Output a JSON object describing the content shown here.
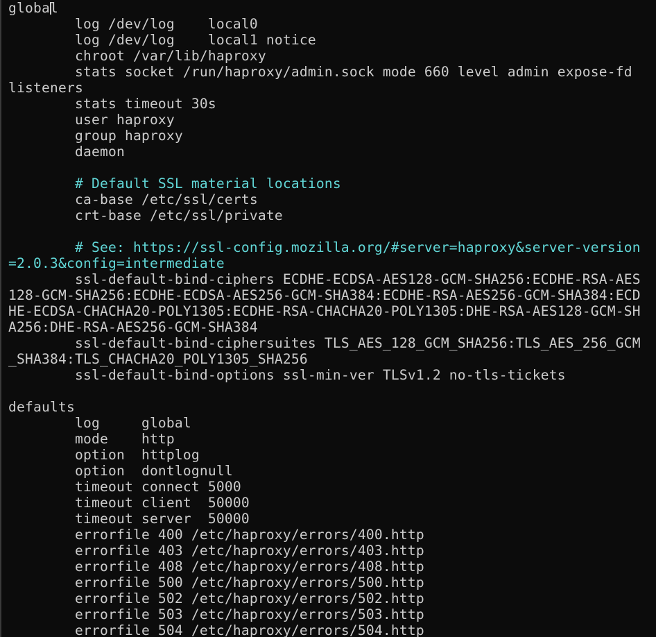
{
  "terminal": {
    "colors": {
      "background": "#0c0c0c",
      "text": "#cccccc",
      "comment": "#61d6d6"
    },
    "lines": [
      {
        "text": "global",
        "kind": "normal"
      },
      {
        "text": "        log /dev/log    local0",
        "kind": "normal"
      },
      {
        "text": "        log /dev/log    local1 notice",
        "kind": "normal"
      },
      {
        "text": "        chroot /var/lib/haproxy",
        "kind": "normal"
      },
      {
        "text": "        stats socket /run/haproxy/admin.sock mode 660 level admin expose-fd",
        "kind": "normal"
      },
      {
        "text": "listeners",
        "kind": "normal"
      },
      {
        "text": "        stats timeout 30s",
        "kind": "normal"
      },
      {
        "text": "        user haproxy",
        "kind": "normal"
      },
      {
        "text": "        group haproxy",
        "kind": "normal"
      },
      {
        "text": "        daemon",
        "kind": "normal"
      },
      {
        "text": "",
        "kind": "blank"
      },
      {
        "text": "        # Default SSL material locations",
        "kind": "comment"
      },
      {
        "text": "        ca-base /etc/ssl/certs",
        "kind": "normal"
      },
      {
        "text": "        crt-base /etc/ssl/private",
        "kind": "normal"
      },
      {
        "text": "",
        "kind": "blank"
      },
      {
        "text": "        # See: https://ssl-config.mozilla.org/#server=haproxy&server-version",
        "kind": "comment"
      },
      {
        "text": "=2.0.3&config=intermediate",
        "kind": "comment"
      },
      {
        "text": "        ssl-default-bind-ciphers ECDHE-ECDSA-AES128-GCM-SHA256:ECDHE-RSA-AES",
        "kind": "normal"
      },
      {
        "text": "128-GCM-SHA256:ECDHE-ECDSA-AES256-GCM-SHA384:ECDHE-RSA-AES256-GCM-SHA384:ECD",
        "kind": "normal"
      },
      {
        "text": "HE-ECDSA-CHACHA20-POLY1305:ECDHE-RSA-CHACHA20-POLY1305:DHE-RSA-AES128-GCM-SH",
        "kind": "normal"
      },
      {
        "text": "A256:DHE-RSA-AES256-GCM-SHA384",
        "kind": "normal"
      },
      {
        "text": "        ssl-default-bind-ciphersuites TLS_AES_128_GCM_SHA256:TLS_AES_256_GCM",
        "kind": "normal"
      },
      {
        "text": "_SHA384:TLS_CHACHA20_POLY1305_SHA256",
        "kind": "normal"
      },
      {
        "text": "        ssl-default-bind-options ssl-min-ver TLSv1.2 no-tls-tickets",
        "kind": "normal"
      },
      {
        "text": "",
        "kind": "blank"
      },
      {
        "text": "defaults",
        "kind": "normal"
      },
      {
        "text": "        log     global",
        "kind": "normal"
      },
      {
        "text": "        mode    http",
        "kind": "normal"
      },
      {
        "text": "        option  httplog",
        "kind": "normal"
      },
      {
        "text": "        option  dontlognull",
        "kind": "normal"
      },
      {
        "text": "        timeout connect 5000",
        "kind": "normal"
      },
      {
        "text": "        timeout client  50000",
        "kind": "normal"
      },
      {
        "text": "        timeout server  50000",
        "kind": "normal"
      },
      {
        "text": "        errorfile 400 /etc/haproxy/errors/400.http",
        "kind": "normal"
      },
      {
        "text": "        errorfile 403 /etc/haproxy/errors/403.http",
        "kind": "normal"
      },
      {
        "text": "        errorfile 408 /etc/haproxy/errors/408.http",
        "kind": "normal"
      },
      {
        "text": "        errorfile 500 /etc/haproxy/errors/500.http",
        "kind": "normal"
      },
      {
        "text": "        errorfile 502 /etc/haproxy/errors/502.http",
        "kind": "normal"
      },
      {
        "text": "        errorfile 503 /etc/haproxy/errors/503.http",
        "kind": "normal"
      },
      {
        "text": "        errorfile 504 /etc/haproxy/errors/504.http",
        "kind": "normal"
      }
    ]
  }
}
